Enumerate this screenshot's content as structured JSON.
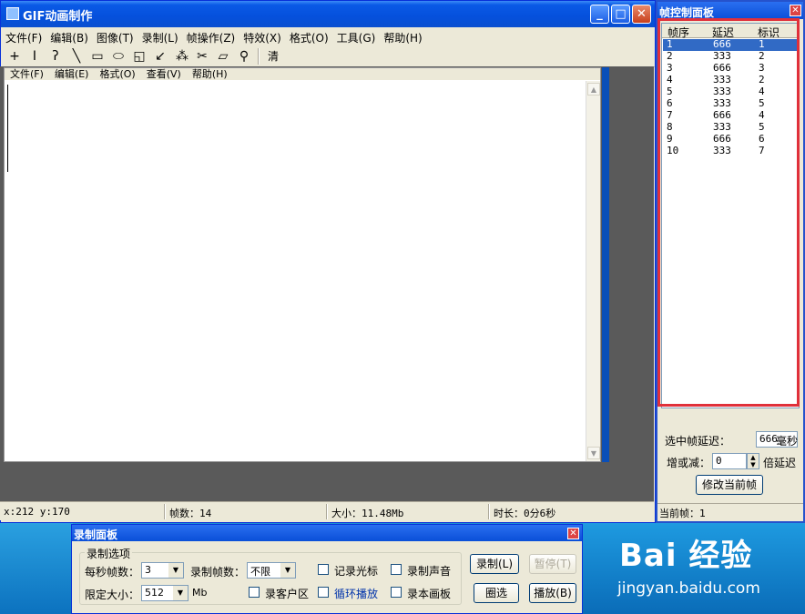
{
  "app": {
    "title": "GIF动画制作",
    "menu": [
      "文件(F)",
      "编辑(B)",
      "图像(T)",
      "录制(L)",
      "帧操作(Z)",
      "特效(X)",
      "格式(O)",
      "工具(G)",
      "帮助(H)"
    ],
    "toolbar": {
      "clear_label": "清"
    },
    "doc_menu": [
      "文件(F)",
      "编辑(E)",
      "格式(O)",
      "查看(V)",
      "帮助(H)"
    ],
    "status": {
      "coords": "x:212 y:170",
      "frames": "帧数：14",
      "size": "大小：11.48Mb",
      "duration": "时长：0分6秒"
    }
  },
  "panel": {
    "title": "帧控制面板",
    "columns": [
      "帧序",
      "延迟",
      "标识"
    ],
    "rows": [
      [
        "1",
        "666",
        "1"
      ],
      [
        "2",
        "333",
        "2"
      ],
      [
        "3",
        "666",
        "3"
      ],
      [
        "4",
        "333",
        "2"
      ],
      [
        "5",
        "333",
        "4"
      ],
      [
        "6",
        "333",
        "5"
      ],
      [
        "7",
        "666",
        "4"
      ],
      [
        "8",
        "333",
        "5"
      ],
      [
        "9",
        "666",
        "6"
      ],
      [
        "10",
        "333",
        "7"
      ]
    ],
    "selected_delay_label": "选中帧延迟：",
    "selected_delay_value": "666",
    "ms_label": "毫秒",
    "incdec_label": "增或减：",
    "incdec_value": "0",
    "multiplier_label": "倍延迟",
    "modify_button": "修改当前帧",
    "current_frame": "当前帧：1"
  },
  "record": {
    "title": "录制面板",
    "group_label": "录制选项",
    "fps_label": "每秒帧数：",
    "fps_value": "3",
    "rec_frames_label": "录制帧数：",
    "rec_frames_value": "不限",
    "size_limit_label": "限定大小：",
    "size_limit_value": "512",
    "size_unit": "Mb",
    "chk_cursor": "记录光标",
    "chk_sound": "录制声音",
    "chk_client": "录客户区",
    "chk_loop": "循环播放",
    "chk_canvas": "录本画板",
    "btn_record": "录制(L)",
    "btn_pause": "暂停(T)",
    "btn_select": "圈选",
    "btn_play": "播放(B)"
  },
  "watermark": {
    "brand": "Bai 经验",
    "url": "jingyan.baidu.com"
  }
}
